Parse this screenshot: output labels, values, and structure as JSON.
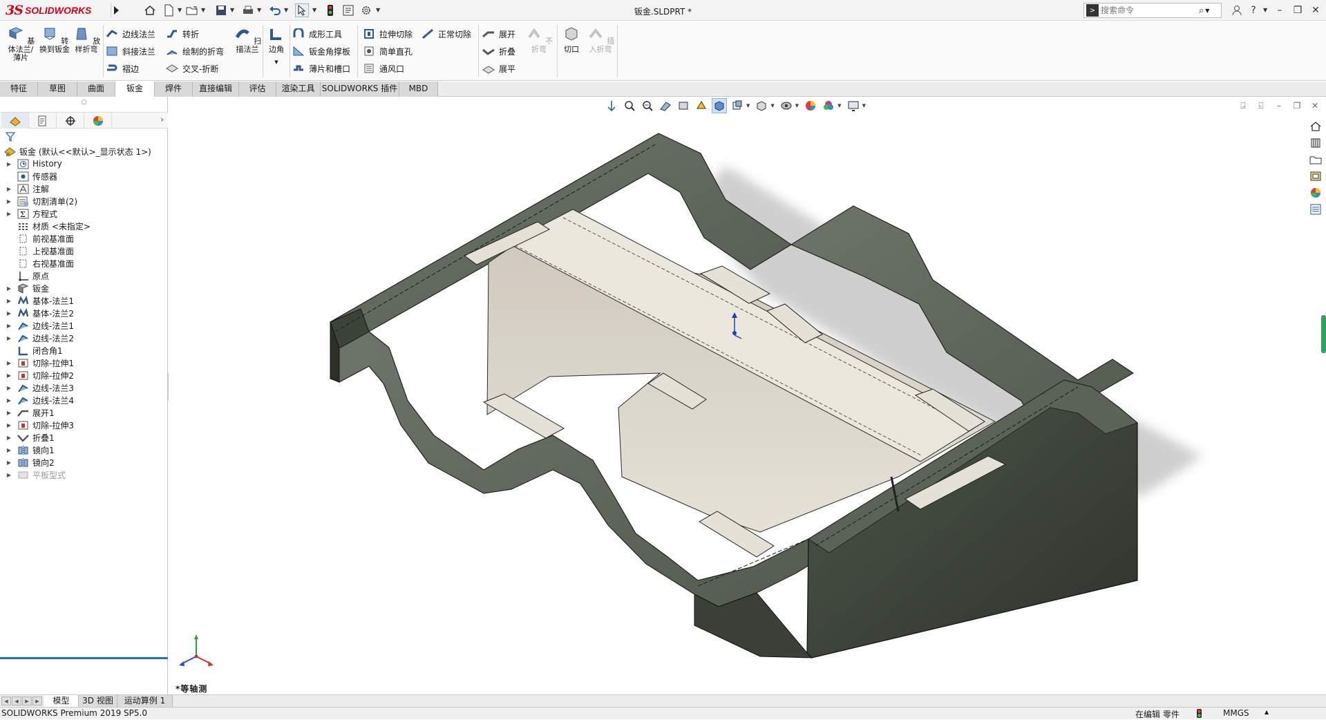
{
  "app": {
    "logo_ds": "3S",
    "logo_name": "SOLIDWORKS",
    "document_title": "钣金.SLDPRT *",
    "search_placeholder": "搜索命令"
  },
  "colors": {
    "brand_red": "#d6001c",
    "sheet_metal": "#5c6458",
    "cut_face": "#e2ddd2",
    "selection_blue": "#1f73b7",
    "scroll_green": "#35a05c"
  },
  "commands": {
    "base_flange": "基体法兰/薄片",
    "convert_to_sheet_metal": "转换到钣金",
    "lofted_bend": "放样折弯",
    "edge_flange": "边线法兰",
    "miter_flange": "斜接法兰",
    "hem": "褶边",
    "jog": "转折",
    "sketched_bend": "绘制的折弯",
    "cross_break": "交叉-折断",
    "swept_flange": "扫描法兰",
    "corners": "边角",
    "forming_tool": "成形工具",
    "sheet_metal_gusset": "钣金角撑板",
    "tab_and_slot": "薄片和槽口",
    "extruded_cut": "拉伸切除",
    "simple_hole": "简单直孔",
    "vent": "通风口",
    "normal_cut": "正常切除",
    "unfold": "展开",
    "fold": "折叠",
    "flatten": "展平",
    "no_bends": "不折弯",
    "rip": "切口",
    "insert_bends": "插入折弯"
  },
  "tabs": [
    "特征",
    "草图",
    "曲面",
    "钣金",
    "焊件",
    "直接编辑",
    "评估",
    "渲染工具",
    "SOLIDWORKS 插件",
    "MBD"
  ],
  "active_tab": "钣金",
  "tree": {
    "root": "钣金 (默认<<默认>_显示状态 1>)",
    "items": [
      {
        "label": "History",
        "icon": "history-icon",
        "expandable": true
      },
      {
        "label": "传感器",
        "icon": "sensor-icon",
        "expandable": false
      },
      {
        "label": "注解",
        "icon": "annotation-icon",
        "expandable": true
      },
      {
        "label": "切割清单(2)",
        "icon": "cut-list-icon",
        "expandable": true
      },
      {
        "label": "方程式",
        "icon": "equation-icon",
        "expandable": true
      },
      {
        "label": "材质 <未指定>",
        "icon": "material-icon",
        "expandable": false
      },
      {
        "label": "前视基准面",
        "icon": "plane-icon",
        "expandable": false
      },
      {
        "label": "上视基准面",
        "icon": "plane-icon",
        "expandable": false
      },
      {
        "label": "右视基准面",
        "icon": "plane-icon",
        "expandable": false
      },
      {
        "label": "原点",
        "icon": "origin-icon",
        "expandable": false
      },
      {
        "label": "钣金",
        "icon": "sheet-metal-icon",
        "expandable": true
      },
      {
        "label": "基体-法兰1",
        "icon": "base-flange-icon",
        "expandable": true
      },
      {
        "label": "基体-法兰2",
        "icon": "base-flange-icon",
        "expandable": true
      },
      {
        "label": "边线-法兰1",
        "icon": "edge-flange-icon",
        "expandable": true
      },
      {
        "label": "边线-法兰2",
        "icon": "edge-flange-icon",
        "expandable": true
      },
      {
        "label": "闭合角1",
        "icon": "closed-corner-icon",
        "expandable": false
      },
      {
        "label": "切除-拉伸1",
        "icon": "cut-extrude-icon",
        "expandable": true
      },
      {
        "label": "切除-拉伸2",
        "icon": "cut-extrude-icon",
        "expandable": true
      },
      {
        "label": "边线-法兰3",
        "icon": "edge-flange-icon",
        "expandable": true
      },
      {
        "label": "边线-法兰4",
        "icon": "edge-flange-icon",
        "expandable": true
      },
      {
        "label": "展开1",
        "icon": "unfold-icon",
        "expandable": true
      },
      {
        "label": "切除-拉伸3",
        "icon": "cut-extrude-icon",
        "expandable": true
      },
      {
        "label": "折叠1",
        "icon": "fold-icon",
        "expandable": true
      },
      {
        "label": "镜向1",
        "icon": "mirror-icon",
        "expandable": true
      },
      {
        "label": "镜向2",
        "icon": "mirror-icon",
        "expandable": true
      },
      {
        "label": "平板型式",
        "icon": "flat-pattern-icon",
        "expandable": true,
        "suppressed": true
      }
    ]
  },
  "viewport": {
    "view_label": "*等轴测"
  },
  "bottom_tabs": [
    "模型",
    "3D 视图",
    "运动算例 1"
  ],
  "active_bottom_tab": "模型",
  "status": {
    "version": "SOLIDWORKS Premium 2019 SP5.0",
    "edit_state": "在编辑 零件",
    "units": "MMGS"
  }
}
